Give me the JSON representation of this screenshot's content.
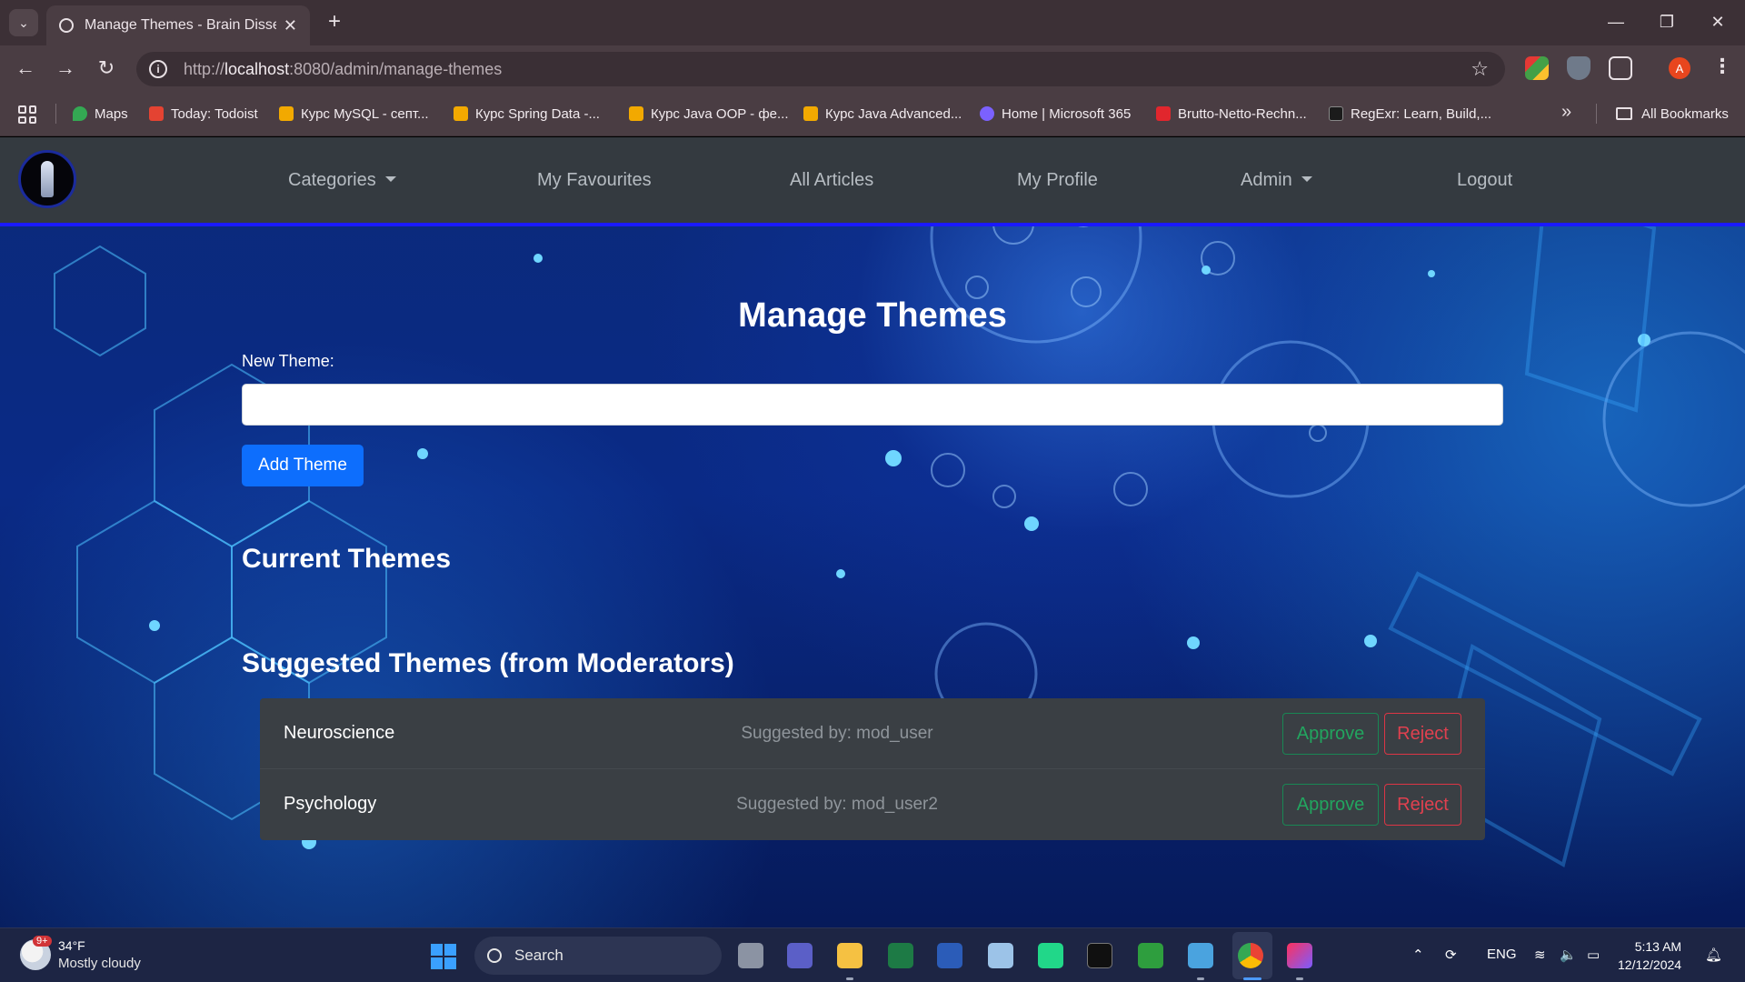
{
  "browser": {
    "tab_title": "Manage Themes - Brain Dissect",
    "url_prefix": "http://",
    "url_host": "localhost",
    "url_path": ":8080/admin/manage-themes",
    "bookmarks": [
      {
        "label": "Maps",
        "color": "#34a853"
      },
      {
        "label": "Today: Todoist",
        "color": "#e44332"
      },
      {
        "label": "Курс MySQL - септ...",
        "color": "#f2a900"
      },
      {
        "label": "Курс Spring Data -...",
        "color": "#f2a900"
      },
      {
        "label": "Курс Java OOP - фе...",
        "color": "#f2a900"
      },
      {
        "label": "Курс Java Advanced...",
        "color": "#f2a900"
      },
      {
        "label": "Home | Microsoft 365",
        "color": "#7b61ff"
      },
      {
        "label": "Brutto-Netto-Rechn...",
        "color": "#e1262d"
      },
      {
        "label": "RegExr: Learn, Build,...",
        "color": "#1b1b1b"
      }
    ],
    "all_bookmarks": "All Bookmarks",
    "profile_initial": "A"
  },
  "nav": {
    "categories": "Categories",
    "favourites": "My Favourites",
    "all_articles": "All Articles",
    "profile": "My Profile",
    "admin": "Admin",
    "logout": "Logout"
  },
  "main": {
    "title": "Manage Themes",
    "new_theme_label": "New Theme:",
    "new_theme_value": "",
    "add_button": "Add Theme",
    "current_title": "Current Themes",
    "suggested_title": "Suggested Themes (from Moderators)",
    "suggestions": [
      {
        "name": "Neuroscience",
        "by": "Suggested by: mod_user",
        "approve": "Approve",
        "reject": "Reject"
      },
      {
        "name": "Psychology",
        "by": "Suggested by: mod_user2",
        "approve": "Approve",
        "reject": "Reject"
      }
    ]
  },
  "taskbar": {
    "weather_badge": "9+",
    "weather_temp": "34°F",
    "weather_desc": "Mostly cloudy",
    "search_label": "Search",
    "lang": "ENG",
    "time": "5:13 AM",
    "date": "12/12/2024"
  }
}
